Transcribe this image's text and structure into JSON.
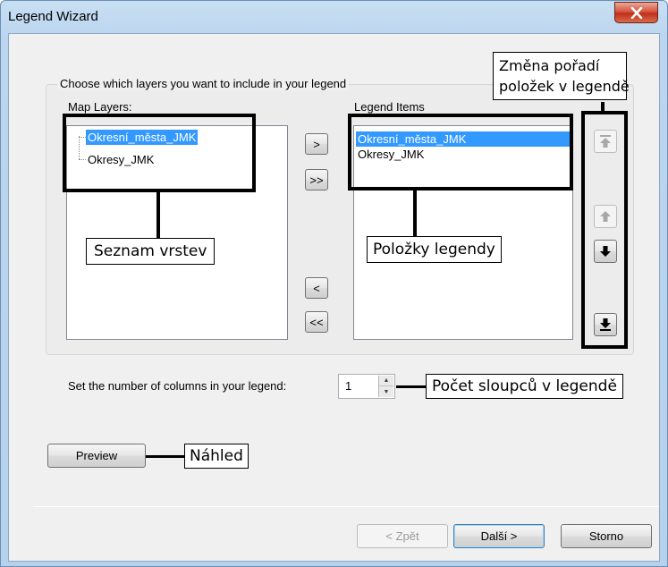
{
  "window": {
    "title": "Legend Wizard",
    "close_glyph": "x"
  },
  "group": {
    "label": "Choose which layers you want to include in your legend"
  },
  "map_layers": {
    "label": "Map Layers:",
    "items": [
      "Okresní_města_JMK",
      "Okresy_JMK"
    ]
  },
  "legend_items": {
    "label": "Legend Items",
    "items": [
      "Okresní_města_JMK",
      "Okresy_JMK"
    ]
  },
  "transfer_buttons": {
    "add": ">",
    "add_all": ">>",
    "remove": "<",
    "remove_all": "<<"
  },
  "order_buttons": {
    "top_icon": "move-to-top-icon",
    "up_icon": "move-up-icon",
    "down_icon": "move-down-icon",
    "bottom_icon": "move-to-bottom-icon"
  },
  "columns": {
    "label": "Set the number of columns in your legend:",
    "value": "1"
  },
  "preview_button": "Preview",
  "footer": {
    "back": "< Zpět",
    "next": "Další >",
    "cancel": "Storno"
  },
  "annotations": {
    "seznam": "Seznam vrstev",
    "polozky": "Položky legendy",
    "zmena_line1": "Změna pořadí",
    "zmena_line2": "položek v legendě",
    "pocet": "Počet sloupců v legendě",
    "nahled": "Náhled"
  }
}
